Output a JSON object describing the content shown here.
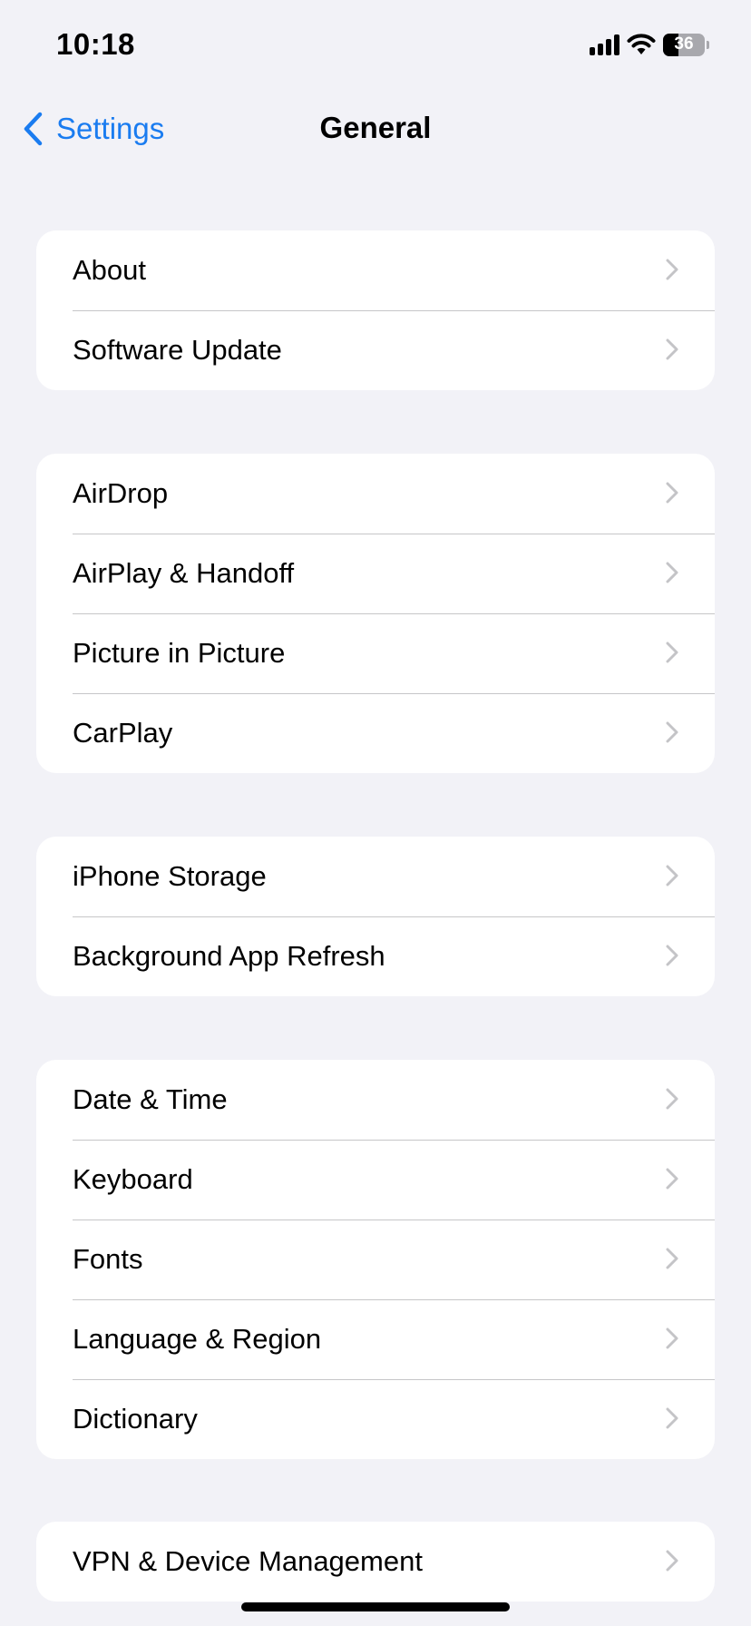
{
  "status_bar": {
    "time": "10:18",
    "battery_percent": "36",
    "icons": [
      "cellular-signal-icon",
      "wifi-icon",
      "battery-icon"
    ]
  },
  "nav": {
    "back_label": "Settings",
    "title": "General",
    "back_icon": "chevron-left-icon"
  },
  "groups": [
    {
      "items": [
        "About",
        "Software Update"
      ]
    },
    {
      "items": [
        "AirDrop",
        "AirPlay & Handoff",
        "Picture in Picture",
        "CarPlay"
      ]
    },
    {
      "items": [
        "iPhone Storage",
        "Background App Refresh"
      ]
    },
    {
      "items": [
        "Date & Time",
        "Keyboard",
        "Fonts",
        "Language & Region",
        "Dictionary"
      ]
    },
    {
      "items": [
        "VPN & Device Management"
      ]
    }
  ],
  "colors": {
    "accent": "#1a7cf0",
    "background": "#f2f2f7",
    "separator": "#c6c6c8",
    "chevron": "#c4c4c7"
  }
}
